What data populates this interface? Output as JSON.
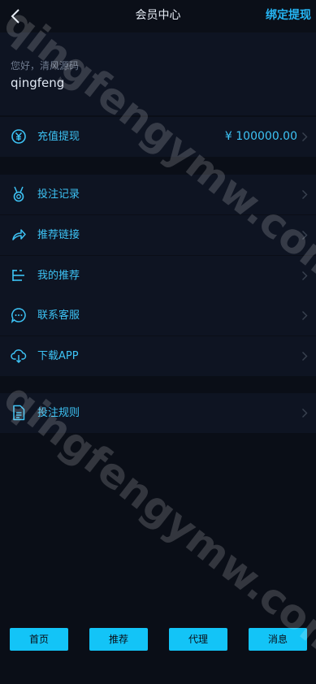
{
  "header": {
    "title": "会员中心",
    "action_label": "绑定提现"
  },
  "profile": {
    "greeting": "您好，清风源码",
    "username": "qingfeng"
  },
  "balance": {
    "label": "充值提现",
    "amount": "¥ 100000.00"
  },
  "menu": [
    {
      "label": "投注记录",
      "icon": "medal-icon"
    },
    {
      "label": "推荐链接",
      "icon": "share-icon"
    },
    {
      "label": "我的推荐",
      "icon": "list-tree-icon"
    },
    {
      "label": "联系客服",
      "icon": "chat-icon"
    },
    {
      "label": "下载APP",
      "icon": "cloud-download-icon"
    }
  ],
  "rules": {
    "label": "投注规则",
    "icon": "document-icon"
  },
  "footer": [
    {
      "label": "首页"
    },
    {
      "label": "推荐"
    },
    {
      "label": "代理"
    },
    {
      "label": "消息"
    }
  ],
  "watermark": "qingfengymw.com",
  "colors": {
    "accent": "#25b6f5",
    "button": "#13c4f7",
    "background": "#0a0e17",
    "panel": "#0e1422"
  }
}
